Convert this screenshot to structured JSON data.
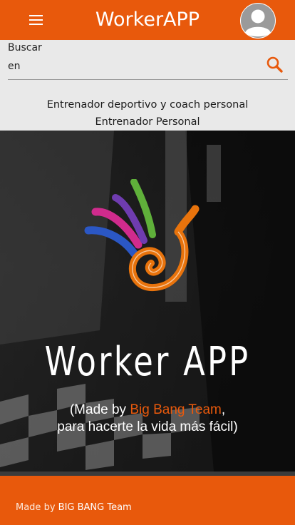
{
  "header": {
    "title": "WorkerAPP",
    "menu_icon": "hamburger-menu-icon",
    "avatar_icon": "user-avatar-icon"
  },
  "search": {
    "label": "Buscar",
    "value": "en",
    "icon": "search-icon",
    "results": [
      "Entrenador deportivo y coach personal",
      "Entrenador Personal"
    ]
  },
  "hero": {
    "title": "Worker APP",
    "subtitle_prefix": "(Made by ",
    "subtitle_team": "Big Bang Team",
    "subtitle_suffix": ",",
    "subtitle_line2": "para hacerte la vida más fácil)"
  },
  "footer": {
    "made_by": "Made by ",
    "team": "BIG BANG Team"
  },
  "colors": {
    "brand": "#e8590c",
    "header_text": "#ffffff",
    "panel_bg": "#f3f3f3"
  }
}
